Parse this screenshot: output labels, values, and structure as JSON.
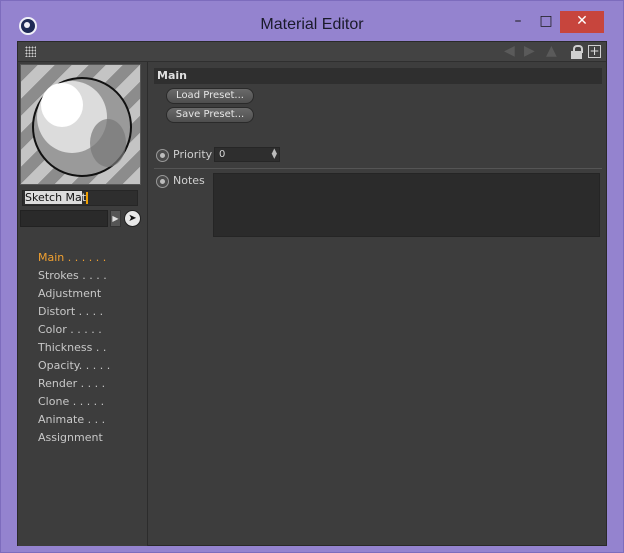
{
  "window": {
    "title": "Material Editor"
  },
  "controls": {
    "minimize": "–",
    "maximize": "□",
    "close": "✕"
  },
  "material": {
    "name_selected": "Sketch Ma",
    "name_rest": "t"
  },
  "nav": {
    "items": [
      {
        "label": "Main . . . . . ."
      },
      {
        "label": "Strokes . . . ."
      },
      {
        "label": "Adjustment"
      },
      {
        "label": "Distort . . . ."
      },
      {
        "label": "Color  . . . . ."
      },
      {
        "label": "Thickness . ."
      },
      {
        "label": "Opacity. . . . ."
      },
      {
        "label": "Render . . . ."
      },
      {
        "label": "Clone  . . . . ."
      },
      {
        "label": "Animate . . ."
      },
      {
        "label": "Assignment"
      }
    ]
  },
  "main": {
    "header": "Main",
    "load_preset": "Load Preset...",
    "save_preset": "Save Preset...",
    "priority_label": "Priority",
    "priority_value": "0",
    "notes_label": "Notes",
    "notes_value": ""
  },
  "colors": {
    "title_bar": "#9483cf",
    "panel": "#3d3d3d",
    "accent": "#f0a030",
    "close": "#c7453d"
  },
  "icons": [
    "app-icon",
    "grip-icon",
    "lock-icon",
    "new-window-icon",
    "arrow-right-icon",
    "pick-cursor-icon"
  ]
}
